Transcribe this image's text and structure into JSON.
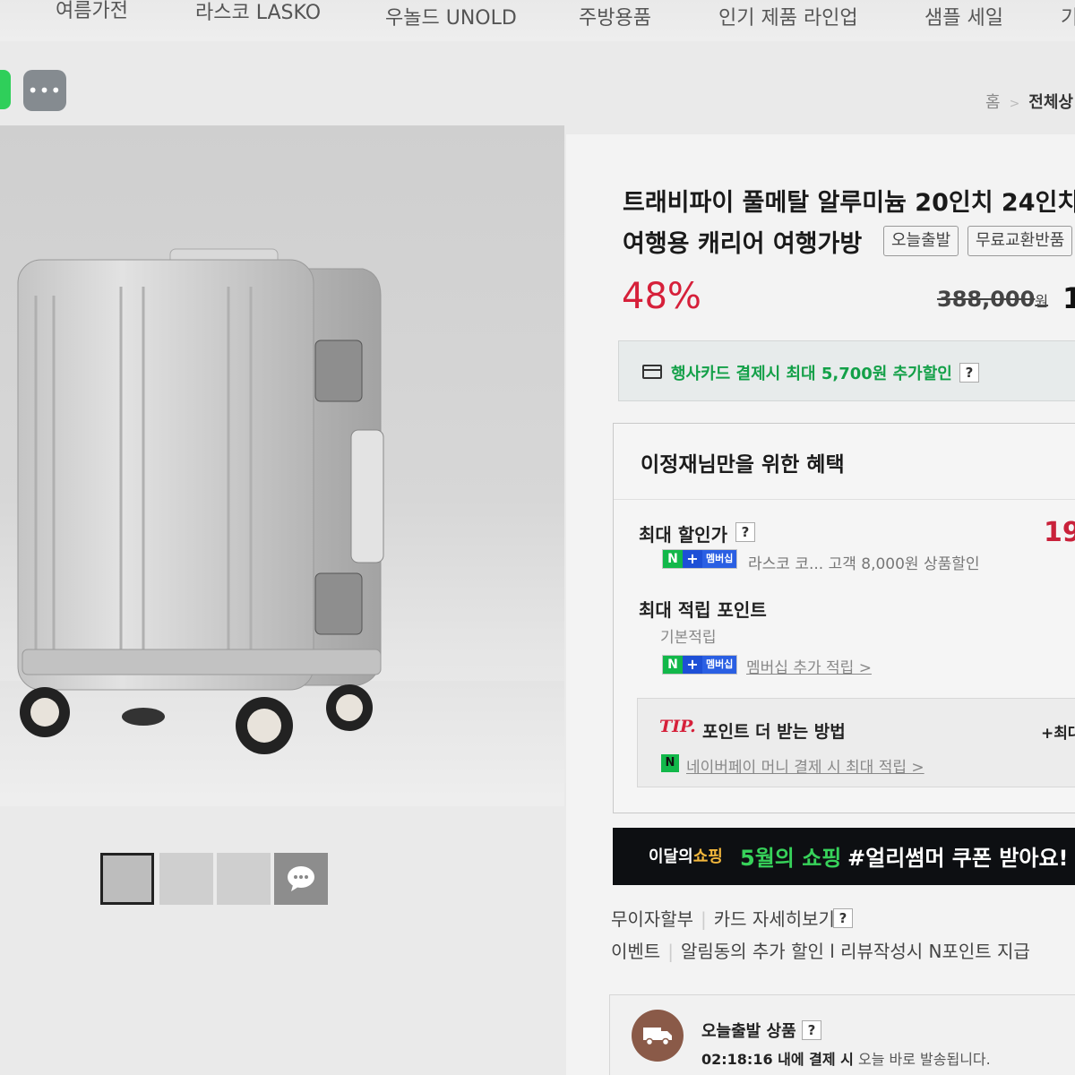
{
  "nav": {
    "items": [
      "여름가전",
      "라스코 LASKO",
      "우놀드 UNOLD",
      "주방용품",
      "인기 제품 라인업",
      "샘플 세일",
      "기"
    ]
  },
  "toolbar": {
    "more_label": "•••"
  },
  "breadcrumb": {
    "home": "홈",
    "separator": ">",
    "current": "전체상"
  },
  "product": {
    "title_line1": "트래비파이 풀메탈 알루미늄 20인치 24인치",
    "title_line2": "여행용 캐리어 여행가방",
    "tags": [
      "오늘출발",
      "무료교환반품"
    ],
    "discount_rate": "48%",
    "original_price": "388,000",
    "original_price_unit": "원",
    "sale_price_peek": "1"
  },
  "card_benefit": {
    "text": "행사카드 결제시 최대 5,700원 추가할인",
    "help": "?"
  },
  "benefits": {
    "title": "이정재님만을 위한 혜택",
    "max_price_label": "최대 할인가",
    "max_price_value": "19",
    "help": "?",
    "badge_n": "N",
    "badge_plus": "+",
    "badge_membership": "멤버십",
    "coupon_text": "라스코 코... 고객 8,000원 상품할인",
    "points_label": "최대 적립 포인트",
    "base_points": "기본적립",
    "member_points": "멤버십 추가 적립 >",
    "tip_mark": "TIP.",
    "tip_title": "포인트 더 받는 방법",
    "tip_bonus": "+최대",
    "npay_icon": "N",
    "npay_text": "네이버페이 머니 결제 시 최대 적립 >"
  },
  "promo": {
    "logo_main": "이달의",
    "logo_accent": "쇼핑",
    "month": "5월의 쇼핑",
    "tagline": "#얼리썸머 쿠폰 받아요!"
  },
  "payment": {
    "installment": "무이자할부",
    "card_detail": "카드 자세히보기",
    "event_label": "이벤트",
    "event_text": "알림동의 추가 할인 l 리뷰작성시 N포인트 지급",
    "help": "?"
  },
  "shipping": {
    "title": "오늘출발 상품",
    "help": "?",
    "time": "02:18:16 내에 결제 시",
    "desc": "오늘 바로 발송됩니다."
  },
  "colors": {
    "discount_red": "#d6203a",
    "naver_green": "#13a048",
    "promo_green": "#37d25a",
    "banner_bg": "#0d0f12"
  }
}
